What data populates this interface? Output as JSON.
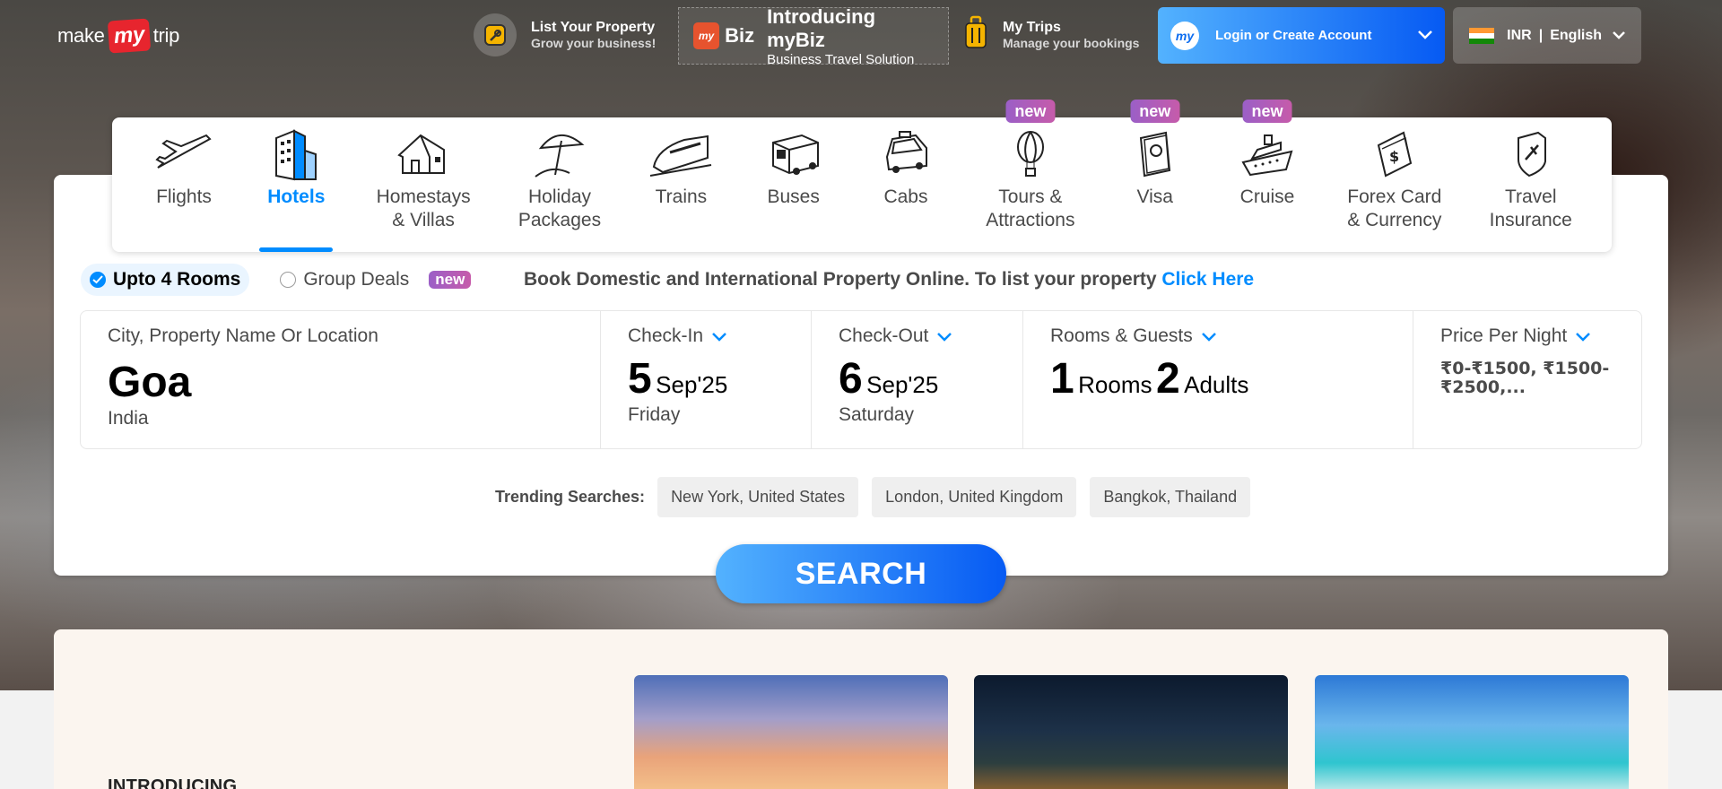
{
  "brand": {
    "make": "make",
    "my": "my",
    "trip": "trip"
  },
  "header": {
    "list_property": {
      "title": "List Your Property",
      "subtitle": "Grow your business!"
    },
    "mybiz": {
      "badge": "my",
      "biz": "Biz",
      "title": "Introducing myBiz",
      "subtitle": "Business Travel Solution"
    },
    "my_trips": {
      "title": "My Trips",
      "subtitle": "Manage your bookings"
    },
    "login": {
      "avatar": "my",
      "label": "Login or Create Account"
    },
    "locale": {
      "currency": "INR",
      "separator": "|",
      "language": "English"
    }
  },
  "nav": [
    {
      "label": "Flights",
      "icon": "plane-icon"
    },
    {
      "label": "Hotels",
      "icon": "hotel-icon",
      "active": true
    },
    {
      "label": "Homestays\n& Villas",
      "icon": "homestay-icon"
    },
    {
      "label": "Holiday\nPackages",
      "icon": "umbrella-icon"
    },
    {
      "label": "Trains",
      "icon": "train-icon"
    },
    {
      "label": "Buses",
      "icon": "bus-icon"
    },
    {
      "label": "Cabs",
      "icon": "cab-icon"
    },
    {
      "label": "Tours &\nAttractions",
      "icon": "balloon-icon",
      "badge": "new"
    },
    {
      "label": "Visa",
      "icon": "passport-icon",
      "badge": "new"
    },
    {
      "label": "Cruise",
      "icon": "ship-icon",
      "badge": "new"
    },
    {
      "label": "Forex Card\n& Currency",
      "icon": "forex-icon"
    },
    {
      "label": "Travel\nInsurance",
      "icon": "insurance-icon"
    }
  ],
  "options": {
    "rooms": "Upto 4 Rooms",
    "group": "Group Deals",
    "group_badge": "new",
    "promo_text": "Book Domestic and International Property Online. To list your property ",
    "promo_link": "Click Here"
  },
  "fields": {
    "city": {
      "label": "City, Property Name Or Location",
      "value": "Goa",
      "sub": "India"
    },
    "checkin": {
      "label": "Check-In",
      "day": "5",
      "month": "Sep'25",
      "weekday": "Friday"
    },
    "checkout": {
      "label": "Check-Out",
      "day": "6",
      "month": "Sep'25",
      "weekday": "Saturday"
    },
    "guests": {
      "label": "Rooms & Guests",
      "rooms_n": "1",
      "rooms_t": "Rooms",
      "adults_n": "2",
      "adults_t": "Adults"
    },
    "price": {
      "label": "Price Per Night",
      "value": "₹0-₹1500, ₹1500-₹2500,..."
    }
  },
  "trending": {
    "label": "Trending Searches:",
    "items": [
      "New York, United States",
      "London, United Kingdom",
      "Bangkok, Thailand"
    ]
  },
  "search_button": "SEARCH",
  "promo_section": {
    "heading": "INTRODUCING"
  },
  "colors": {
    "primary": "#008cff",
    "gradient_start": "#53b2fe",
    "gradient_end": "#065af3",
    "badge": "#9b5fc7",
    "logo_red": "#e7252e"
  }
}
